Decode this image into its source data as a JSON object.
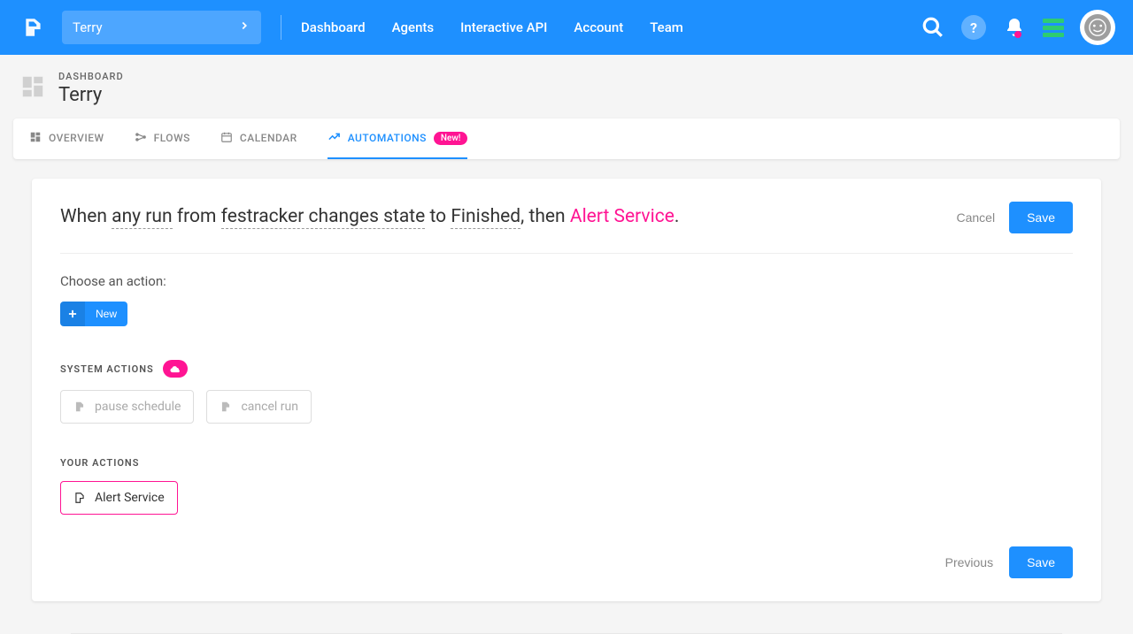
{
  "header": {
    "project_name": "Terry",
    "nav": {
      "dashboard": "Dashboard",
      "agents": "Agents",
      "interactive_api": "Interactive API",
      "account": "Account",
      "team": "Team"
    }
  },
  "breadcrumb": {
    "label": "DASHBOARD",
    "title": "Terry"
  },
  "tabs": {
    "overview": "OVERVIEW",
    "flows": "FLOWS",
    "calendar": "CALENDAR",
    "automations": "AUTOMATIONS",
    "new_badge": "New!"
  },
  "rule": {
    "prefix": "When ",
    "token_run": "any run",
    "mid1": " from ",
    "token_flow": "festracker changes state",
    "mid2": " to ",
    "token_state": "Finished",
    "mid3": ", then ",
    "token_action": "Alert Service",
    "suffix": "."
  },
  "actions": {
    "cancel": "Cancel",
    "save": "Save",
    "previous": "Previous"
  },
  "choose_action": {
    "label": "Choose an action:",
    "new_btn": "New"
  },
  "system_actions": {
    "heading": "SYSTEM ACTIONS",
    "pause": "pause schedule",
    "cancel": "cancel run"
  },
  "your_actions": {
    "heading": "YOUR ACTIONS",
    "alert_service": "Alert Service"
  }
}
